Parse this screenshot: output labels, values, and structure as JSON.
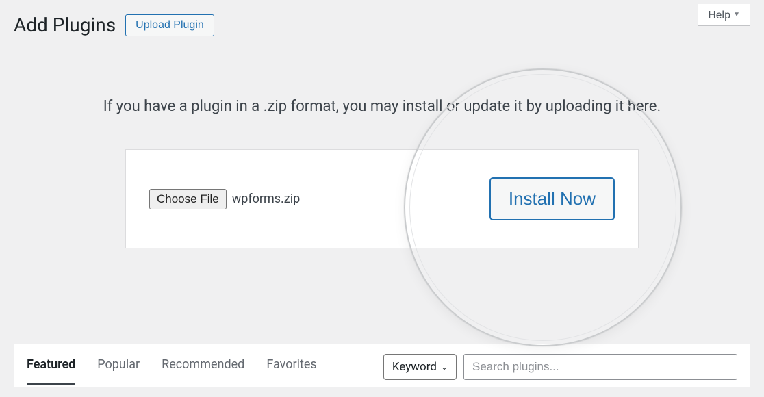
{
  "header": {
    "title": "Add Plugins",
    "upload_button_label": "Upload Plugin",
    "help_label": "Help"
  },
  "upload_panel": {
    "description": "If you have a plugin in a .zip format, you may install or update it by uploading it here.",
    "choose_file_label": "Choose File",
    "selected_file": "wpforms.zip",
    "install_button_label": "Install Now"
  },
  "filter_bar": {
    "tabs": [
      {
        "label": "Featured",
        "active": true
      },
      {
        "label": "Popular",
        "active": false
      },
      {
        "label": "Recommended",
        "active": false
      },
      {
        "label": "Favorites",
        "active": false
      }
    ],
    "search_type_label": "Keyword",
    "search_placeholder": "Search plugins..."
  }
}
